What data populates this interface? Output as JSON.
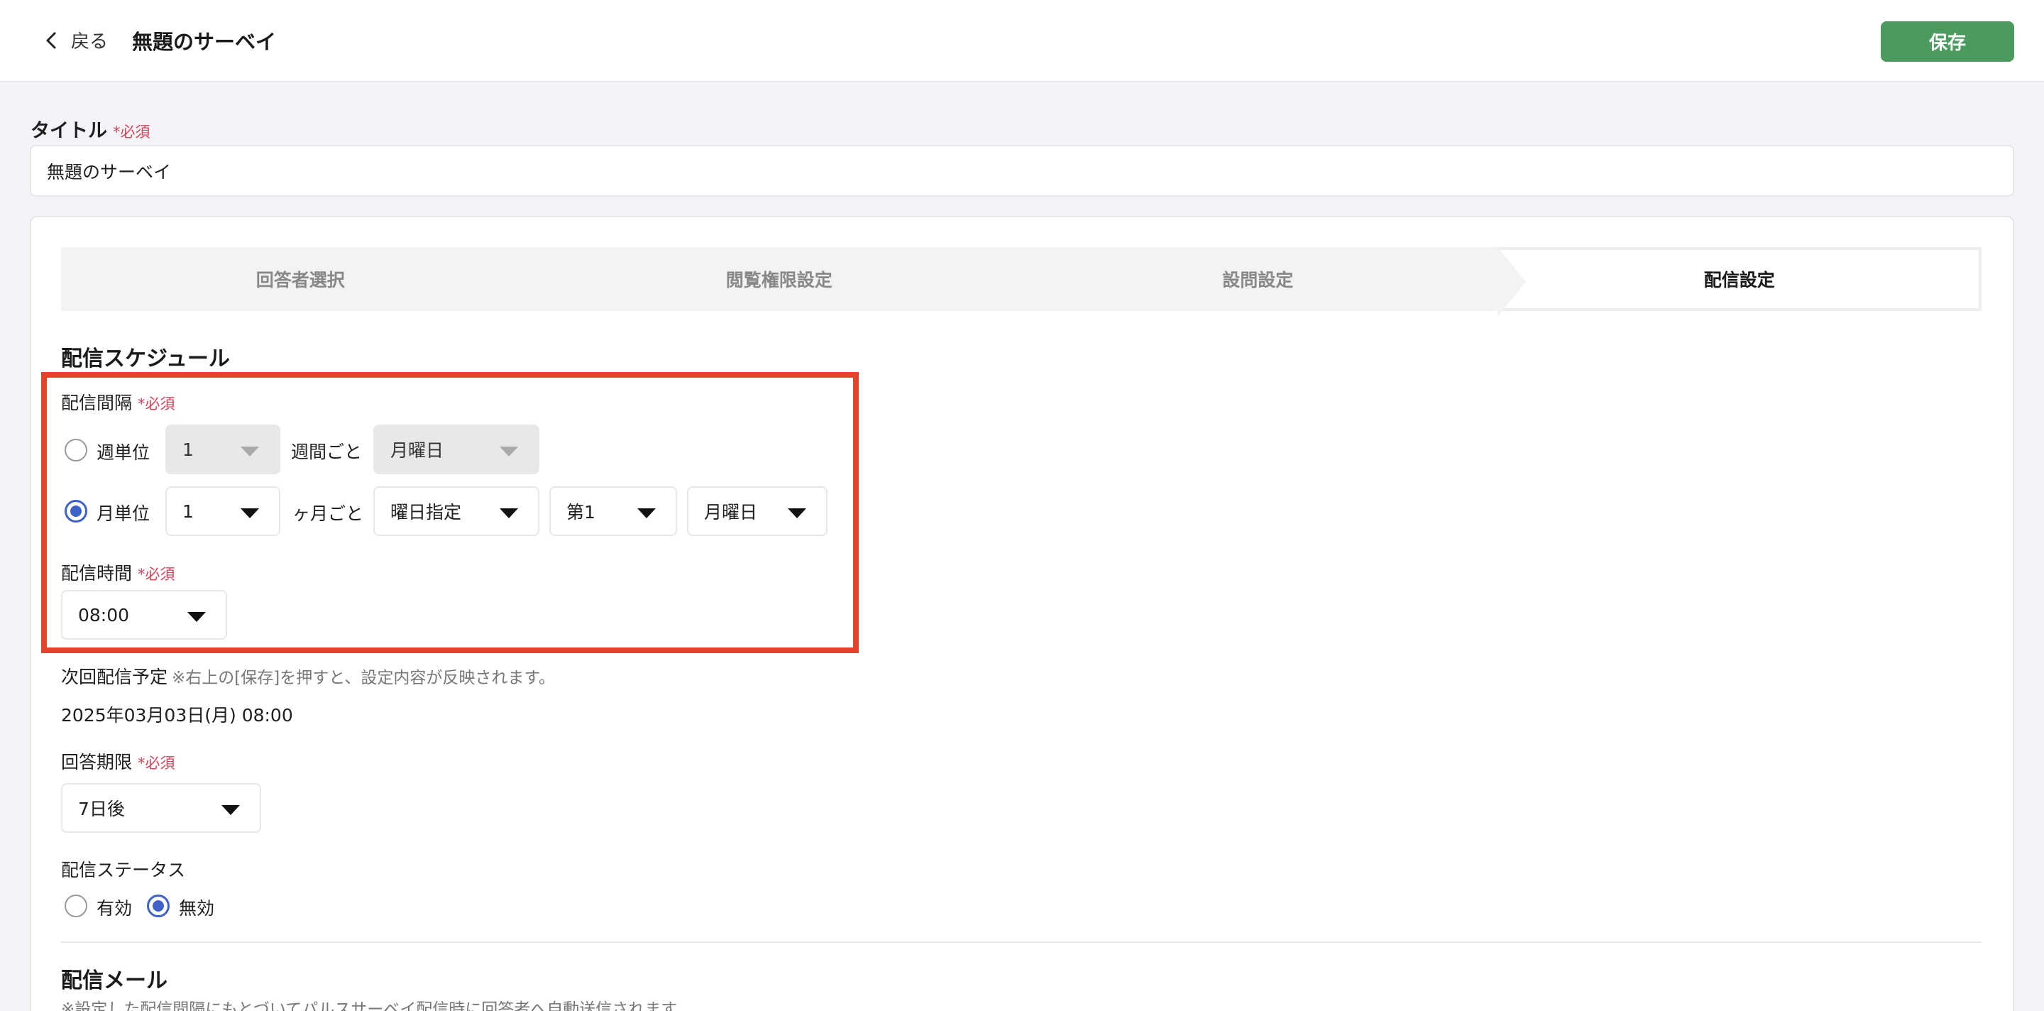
{
  "header": {
    "back_label": "戻る",
    "title": "無題のサーベイ",
    "save_label": "保存"
  },
  "title_field": {
    "label": "タイトル",
    "required": "*必須",
    "value": "無題のサーベイ"
  },
  "steps": [
    {
      "label": "回答者選択"
    },
    {
      "label": "閲覧権限設定"
    },
    {
      "label": "設問設定"
    },
    {
      "label": "配信設定"
    }
  ],
  "schedule": {
    "section_title": "配信スケジュール",
    "interval_label": "配信間隔",
    "required": "*必須",
    "weekly": {
      "label": "週単位",
      "count": "1",
      "unit_text": "週間ごと",
      "day": "月曜日",
      "checked": false
    },
    "monthly": {
      "label": "月単位",
      "count": "1",
      "unit_text": "ヶ月ごと",
      "mode": "曜日指定",
      "week": "第1",
      "day": "月曜日",
      "checked": true
    },
    "time_label": "配信時間",
    "time_value": "08:00"
  },
  "next_delivery": {
    "label": "次回配信予定",
    "note": "※右上の[保存]を押すと、設定内容が反映されます。",
    "value": "2025年03月03日(月) 08:00"
  },
  "deadline": {
    "label": "回答期限",
    "required": "*必須",
    "value": "7日後"
  },
  "status": {
    "label": "配信ステータス",
    "enabled_label": "有効",
    "disabled_label": "無効",
    "selected": "無効"
  },
  "mail": {
    "title": "配信メール",
    "note": "※設定した配信間隔にもとづいてパルスサーベイ配信時に回答者へ自動送信されます。"
  },
  "colors": {
    "accent": "#3f62c9",
    "save": "#4b9a5e",
    "required": "#d2455a",
    "highlight": "#e5432b"
  }
}
